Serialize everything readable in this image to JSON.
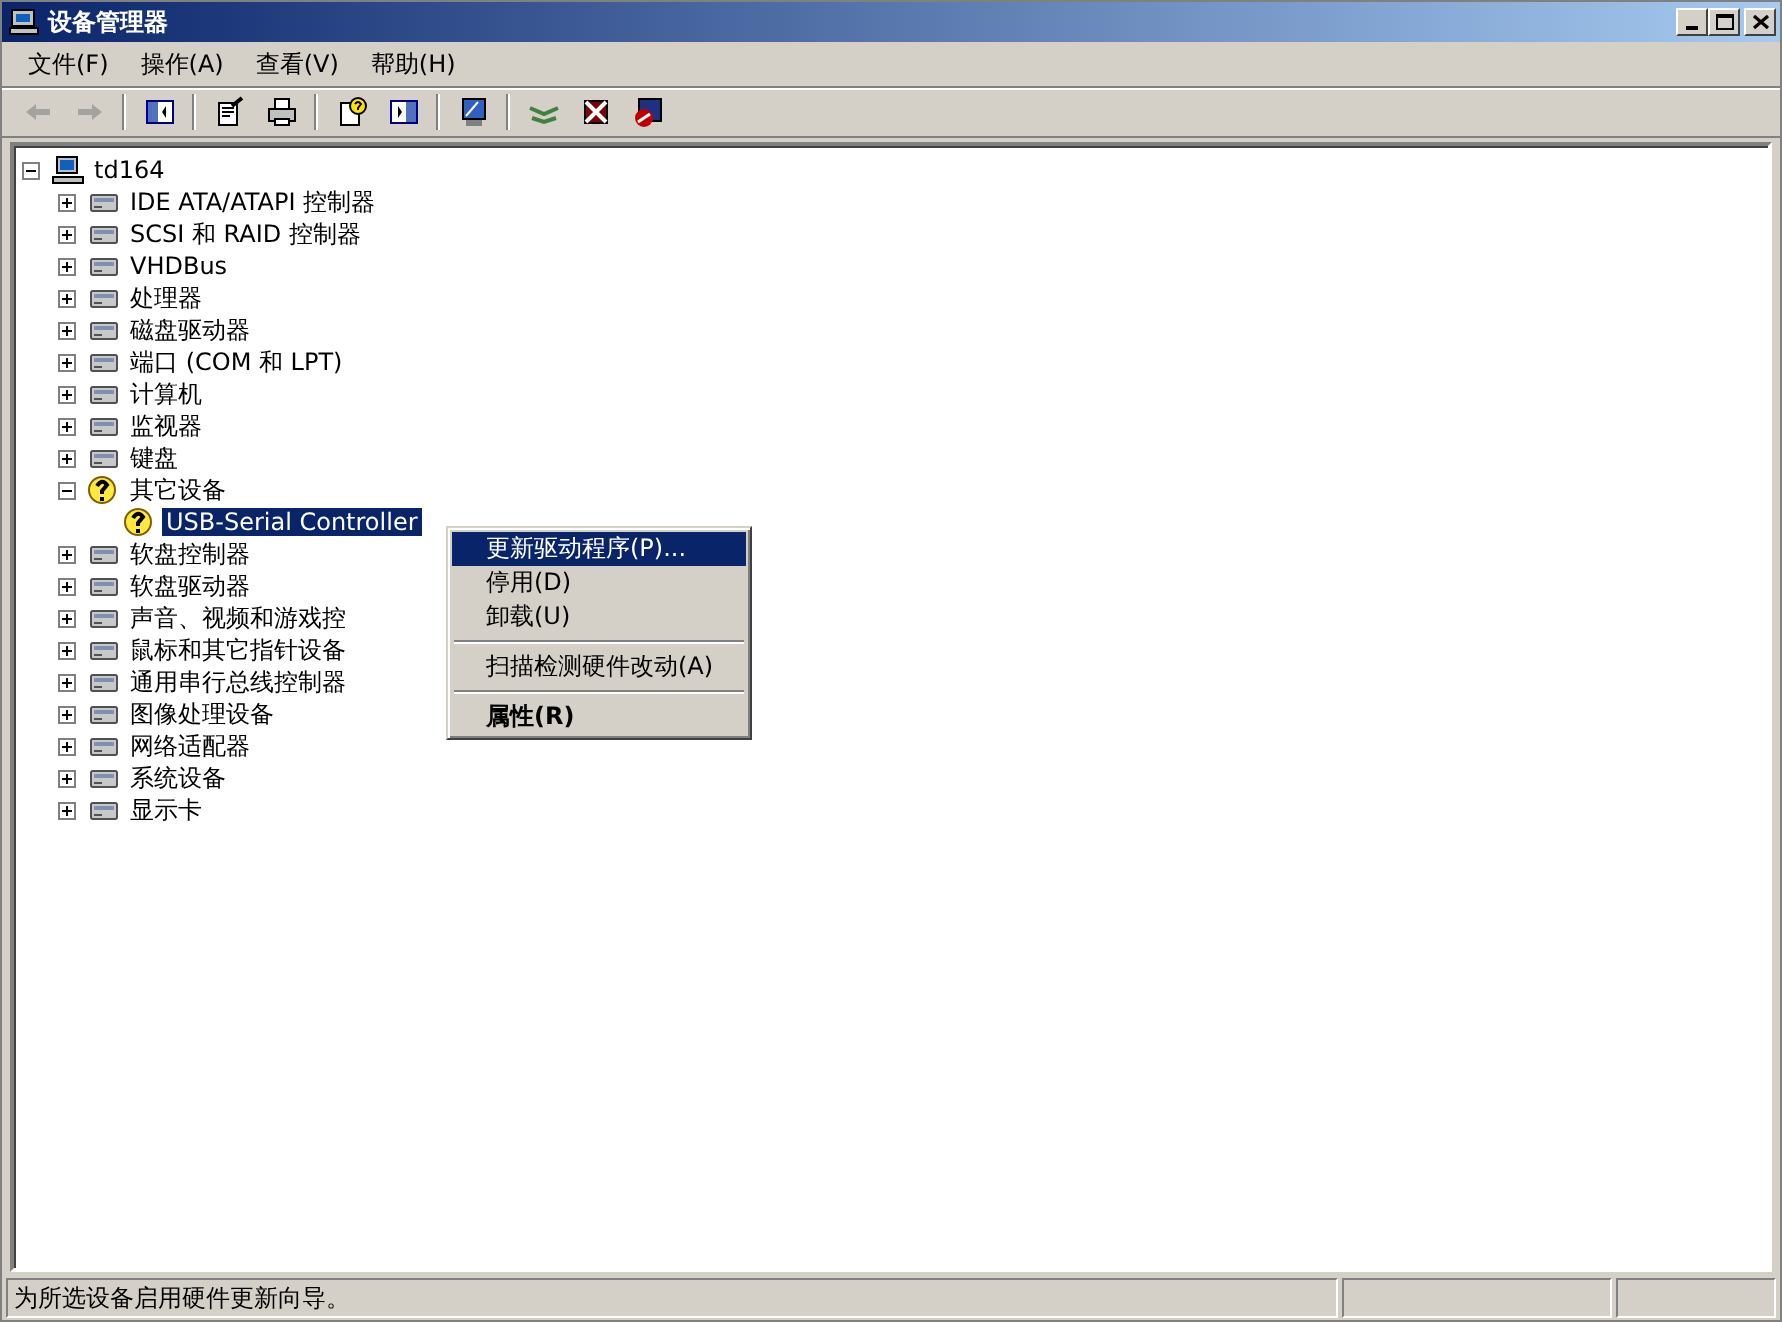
{
  "window": {
    "title": "设备管理器"
  },
  "menu_bar": [
    {
      "label": "文件(F)"
    },
    {
      "label": "操作(A)"
    },
    {
      "label": "查看(V)"
    },
    {
      "label": "帮助(H)"
    }
  ],
  "toolbar": [
    {
      "kind": "button",
      "disabled": true
    },
    {
      "kind": "button",
      "disabled": true
    },
    {
      "kind": "separator"
    },
    {
      "kind": "button",
      "disabled": false
    },
    {
      "kind": "separator"
    },
    {
      "kind": "button",
      "disabled": false
    },
    {
      "kind": "button",
      "disabled": false
    },
    {
      "kind": "separator"
    },
    {
      "kind": "button",
      "disabled": false
    },
    {
      "kind": "button",
      "disabled": false
    },
    {
      "kind": "separator"
    },
    {
      "kind": "button",
      "disabled": false
    },
    {
      "kind": "separator"
    },
    {
      "kind": "button",
      "disabled": false
    },
    {
      "kind": "button",
      "disabled": false
    },
    {
      "kind": "button",
      "disabled": false
    }
  ],
  "tree": {
    "label": "td164",
    "kind": "node",
    "expanded": true,
    "selected": false,
    "children": [
      {
        "label": "IDE ATA/ATAPI 控制器",
        "kind": "node",
        "expanded": false,
        "selected": false,
        "problem": false
      },
      {
        "label": "SCSI 和 RAID 控制器",
        "kind": "node",
        "expanded": false,
        "selected": false,
        "problem": false
      },
      {
        "label": "VHDBus",
        "kind": "node",
        "expanded": false,
        "selected": false,
        "problem": false
      },
      {
        "label": "处理器",
        "kind": "node",
        "expanded": false,
        "selected": false,
        "problem": false
      },
      {
        "label": "磁盘驱动器",
        "kind": "node",
        "expanded": false,
        "selected": false,
        "problem": false
      },
      {
        "label": "端口 (COM 和 LPT)",
        "kind": "node",
        "expanded": false,
        "selected": false,
        "problem": false
      },
      {
        "label": "计算机",
        "kind": "node",
        "expanded": false,
        "selected": false,
        "problem": false
      },
      {
        "label": "监视器",
        "kind": "node",
        "expanded": false,
        "selected": false,
        "problem": false
      },
      {
        "label": "键盘",
        "kind": "node",
        "expanded": false,
        "selected": false,
        "problem": false
      },
      {
        "label": "其它设备",
        "kind": "node",
        "expanded": true,
        "selected": false,
        "problem": true,
        "children": [
          {
            "label": "USB-Serial Controller",
            "kind": "leaf",
            "selected": true,
            "problem": true
          }
        ]
      },
      {
        "label": "软盘控制器",
        "kind": "node",
        "expanded": false,
        "selected": false,
        "problem": false
      },
      {
        "label": "软盘驱动器",
        "kind": "node",
        "expanded": false,
        "selected": false,
        "problem": false
      },
      {
        "label": "声音、视频和游戏控",
        "kind": "node",
        "expanded": false,
        "selected": false,
        "problem": false
      },
      {
        "label": "鼠标和其它指针设备",
        "kind": "node",
        "expanded": false,
        "selected": false,
        "problem": false
      },
      {
        "label": "通用串行总线控制器",
        "kind": "node",
        "expanded": false,
        "selected": false,
        "problem": false
      },
      {
        "label": "图像处理设备",
        "kind": "node",
        "expanded": false,
        "selected": false,
        "problem": false
      },
      {
        "label": "网络适配器",
        "kind": "node",
        "expanded": false,
        "selected": false,
        "problem": false
      },
      {
        "label": "系统设备",
        "kind": "node",
        "expanded": false,
        "selected": false,
        "problem": false
      },
      {
        "label": "显示卡",
        "kind": "node",
        "expanded": false,
        "selected": false,
        "problem": false
      }
    ]
  },
  "context_menu": [
    {
      "kind": "item",
      "label": "更新驱动程序(P)...",
      "selected": true,
      "default": false
    },
    {
      "kind": "item",
      "label": "停用(D)",
      "selected": false,
      "default": false
    },
    {
      "kind": "item",
      "label": "卸载(U)",
      "selected": false,
      "default": false
    },
    {
      "kind": "separator"
    },
    {
      "kind": "item",
      "label": "扫描检测硬件改动(A)",
      "selected": false,
      "default": false
    },
    {
      "kind": "separator"
    },
    {
      "kind": "item",
      "label": "属性(R)",
      "selected": false,
      "default": true
    }
  ],
  "status_bar": {
    "text": "为所选设备启用硬件更新向导。"
  }
}
